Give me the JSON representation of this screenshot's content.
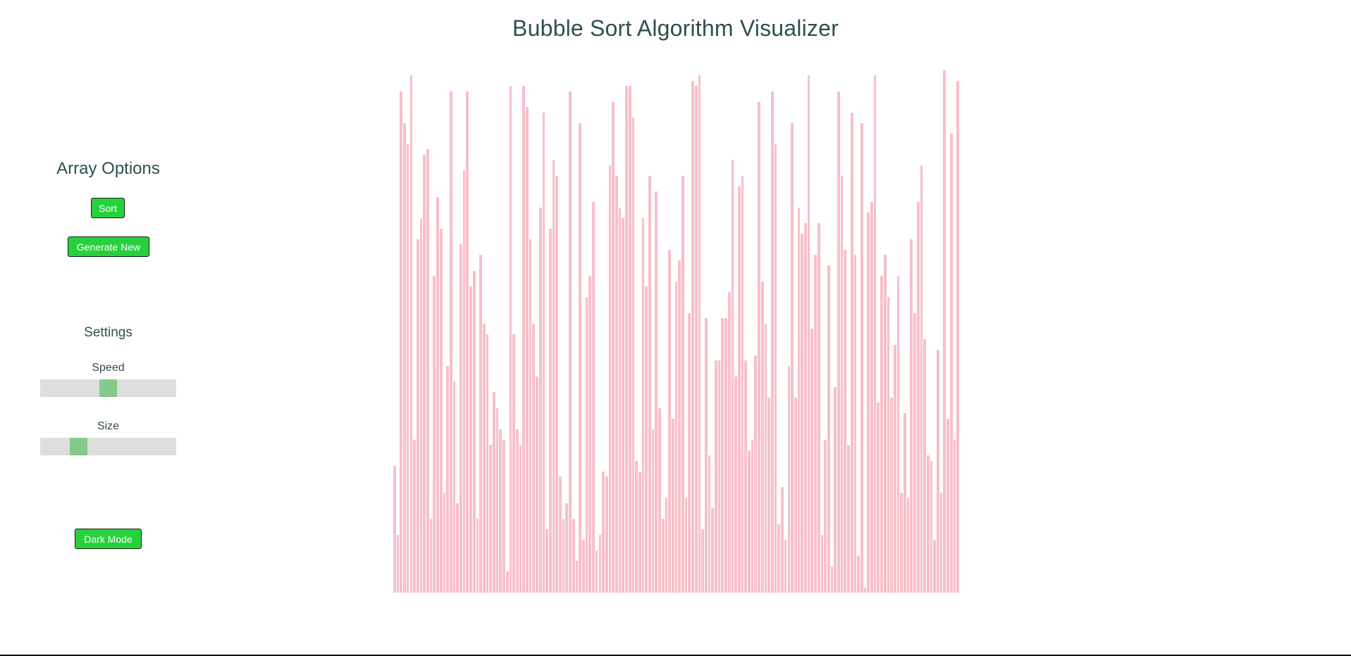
{
  "title": "Bubble Sort Algorithm Visualizer",
  "sidebar": {
    "options_heading": "Array Options",
    "sort_label": "Sort",
    "generate_label": "Generate New",
    "settings_heading": "Settings",
    "speed_label": "Speed",
    "size_label": "Size",
    "dark_mode_label": "Dark Mode",
    "speed_value": 0.5,
    "size_value": 0.25
  },
  "colors": {
    "bar": "#f8bfca",
    "button": "#27d13c",
    "slider_thumb": "#86c98a",
    "slider_track": "#dedede",
    "text": "#2f4f4f"
  },
  "chart_data": {
    "type": "bar",
    "title": "",
    "xlabel": "",
    "ylabel": "",
    "ylim": [
      0,
      100
    ],
    "values": [
      24,
      11,
      95,
      89,
      85,
      98,
      29,
      67,
      71,
      83,
      84,
      14,
      60,
      75,
      69,
      19,
      43,
      95,
      40,
      17,
      66,
      80,
      95,
      58,
      61,
      14,
      64,
      51,
      49,
      28,
      38,
      35,
      31,
      29,
      4,
      96,
      49,
      31,
      28,
      96,
      92,
      67,
      51,
      41,
      73,
      91,
      12,
      69,
      82,
      79,
      22,
      14,
      17,
      95,
      14,
      6,
      89,
      10,
      56,
      60,
      74,
      8,
      11,
      23,
      22,
      81,
      93,
      79,
      73,
      71,
      96,
      96,
      90,
      25,
      23,
      71,
      58,
      79,
      31,
      76,
      35,
      14,
      18,
      65,
      33,
      59,
      63,
      79,
      18,
      53,
      97,
      96,
      98,
      12,
      52,
      26,
      16,
      44,
      44,
      52,
      52,
      57,
      82,
      41,
      77,
      79,
      44,
      27,
      29,
      45,
      93,
      59,
      51,
      37,
      95,
      85,
      13,
      20,
      10,
      43,
      89,
      37,
      73,
      68,
      70,
      98,
      50,
      64,
      70,
      11,
      29,
      62,
      5,
      39,
      95,
      79,
      65,
      28,
      91,
      64,
      7,
      89,
      1,
      72,
      74,
      98,
      36,
      60,
      64,
      56,
      37,
      47,
      60,
      19,
      34,
      18,
      67,
      53,
      74,
      81,
      48,
      26,
      25,
      10,
      46,
      19,
      99,
      33,
      87,
      29,
      97
    ]
  }
}
